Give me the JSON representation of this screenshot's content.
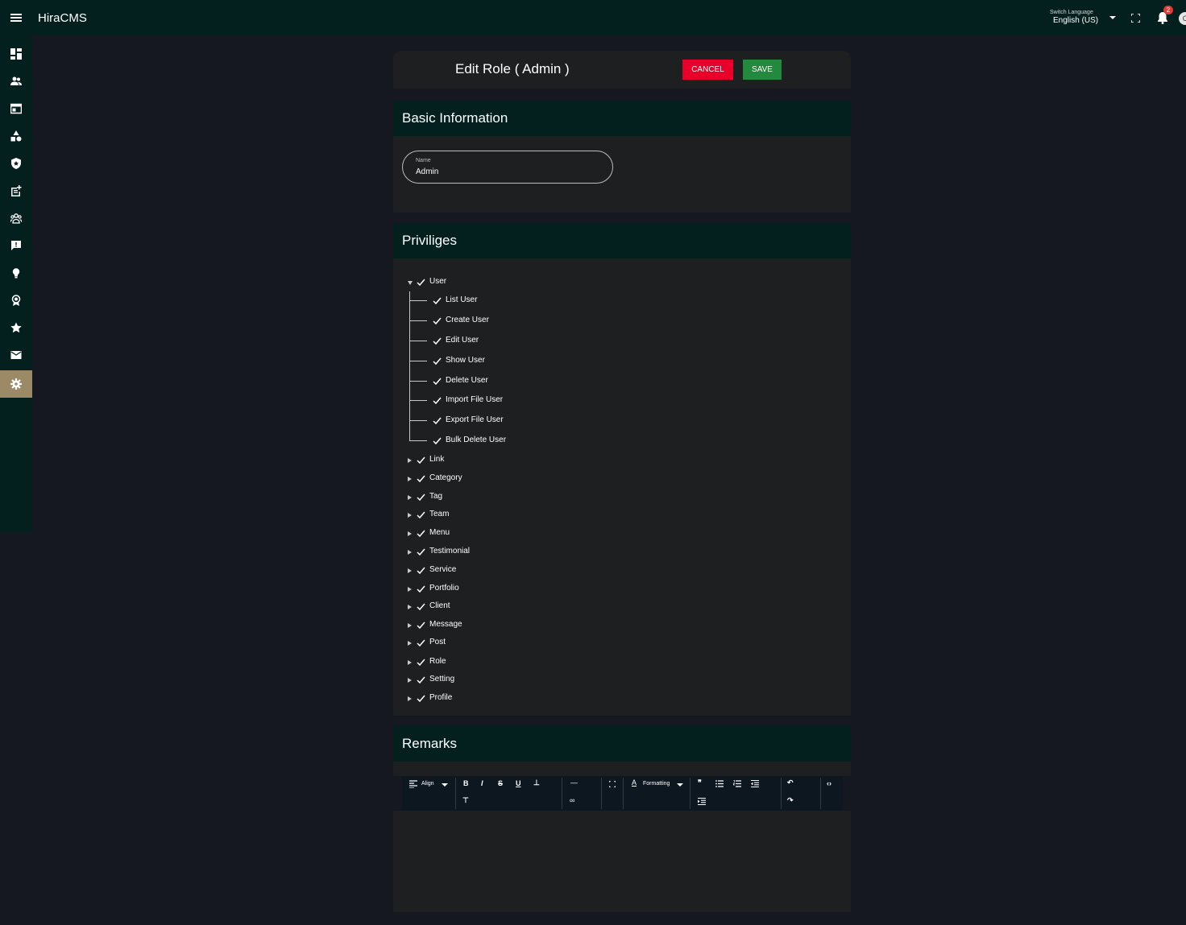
{
  "app": {
    "title": "HiraCMS"
  },
  "topbar": {
    "switch_language_label": "Switch Language",
    "language_value": "English (US)",
    "notification_count": "2",
    "avatar_initial": "C"
  },
  "sidebar": {
    "items": [
      {
        "icon": "dashboard-icon"
      },
      {
        "icon": "users-icon"
      },
      {
        "icon": "pages-icon"
      },
      {
        "icon": "category-icon"
      },
      {
        "icon": "shield-icon"
      },
      {
        "icon": "post-add-icon"
      },
      {
        "icon": "team-icon"
      },
      {
        "icon": "testimonial-icon"
      },
      {
        "icon": "idea-icon"
      },
      {
        "icon": "award-icon"
      },
      {
        "icon": "star-icon"
      },
      {
        "icon": "mail-icon"
      },
      {
        "icon": "settings-icon",
        "active": true
      }
    ],
    "active_color": "#9c8a66"
  },
  "header": {
    "title": "Edit Role ( Admin )",
    "cancel_label": "CANCEL",
    "save_label": "SAVE"
  },
  "basic_info": {
    "heading": "Basic Information",
    "name_label": "Name",
    "name_value": "Admin"
  },
  "privileges": {
    "heading": "Priviliges",
    "user": {
      "label": "User",
      "children": [
        "List User",
        "Create User",
        "Edit User",
        "Show User",
        "Delete User",
        "Import File User",
        "Export File User",
        "Bulk Delete User"
      ]
    },
    "others": [
      "Link",
      "Category",
      "Tag",
      "Team",
      "Menu",
      "Testimonial",
      "Service",
      "Portfolio",
      "Client",
      "Message",
      "Post",
      "Role",
      "Setting",
      "Profile"
    ]
  },
  "remarks": {
    "heading": "Remarks",
    "toolbar": {
      "align_label": "Align",
      "formatting_label": "Formatting"
    }
  },
  "colors": {
    "topbar_bg": "#03201f",
    "page_bg": "#151821",
    "card_bg": "#1d1f20",
    "cancel": "#e8002b",
    "save": "#23893f"
  }
}
